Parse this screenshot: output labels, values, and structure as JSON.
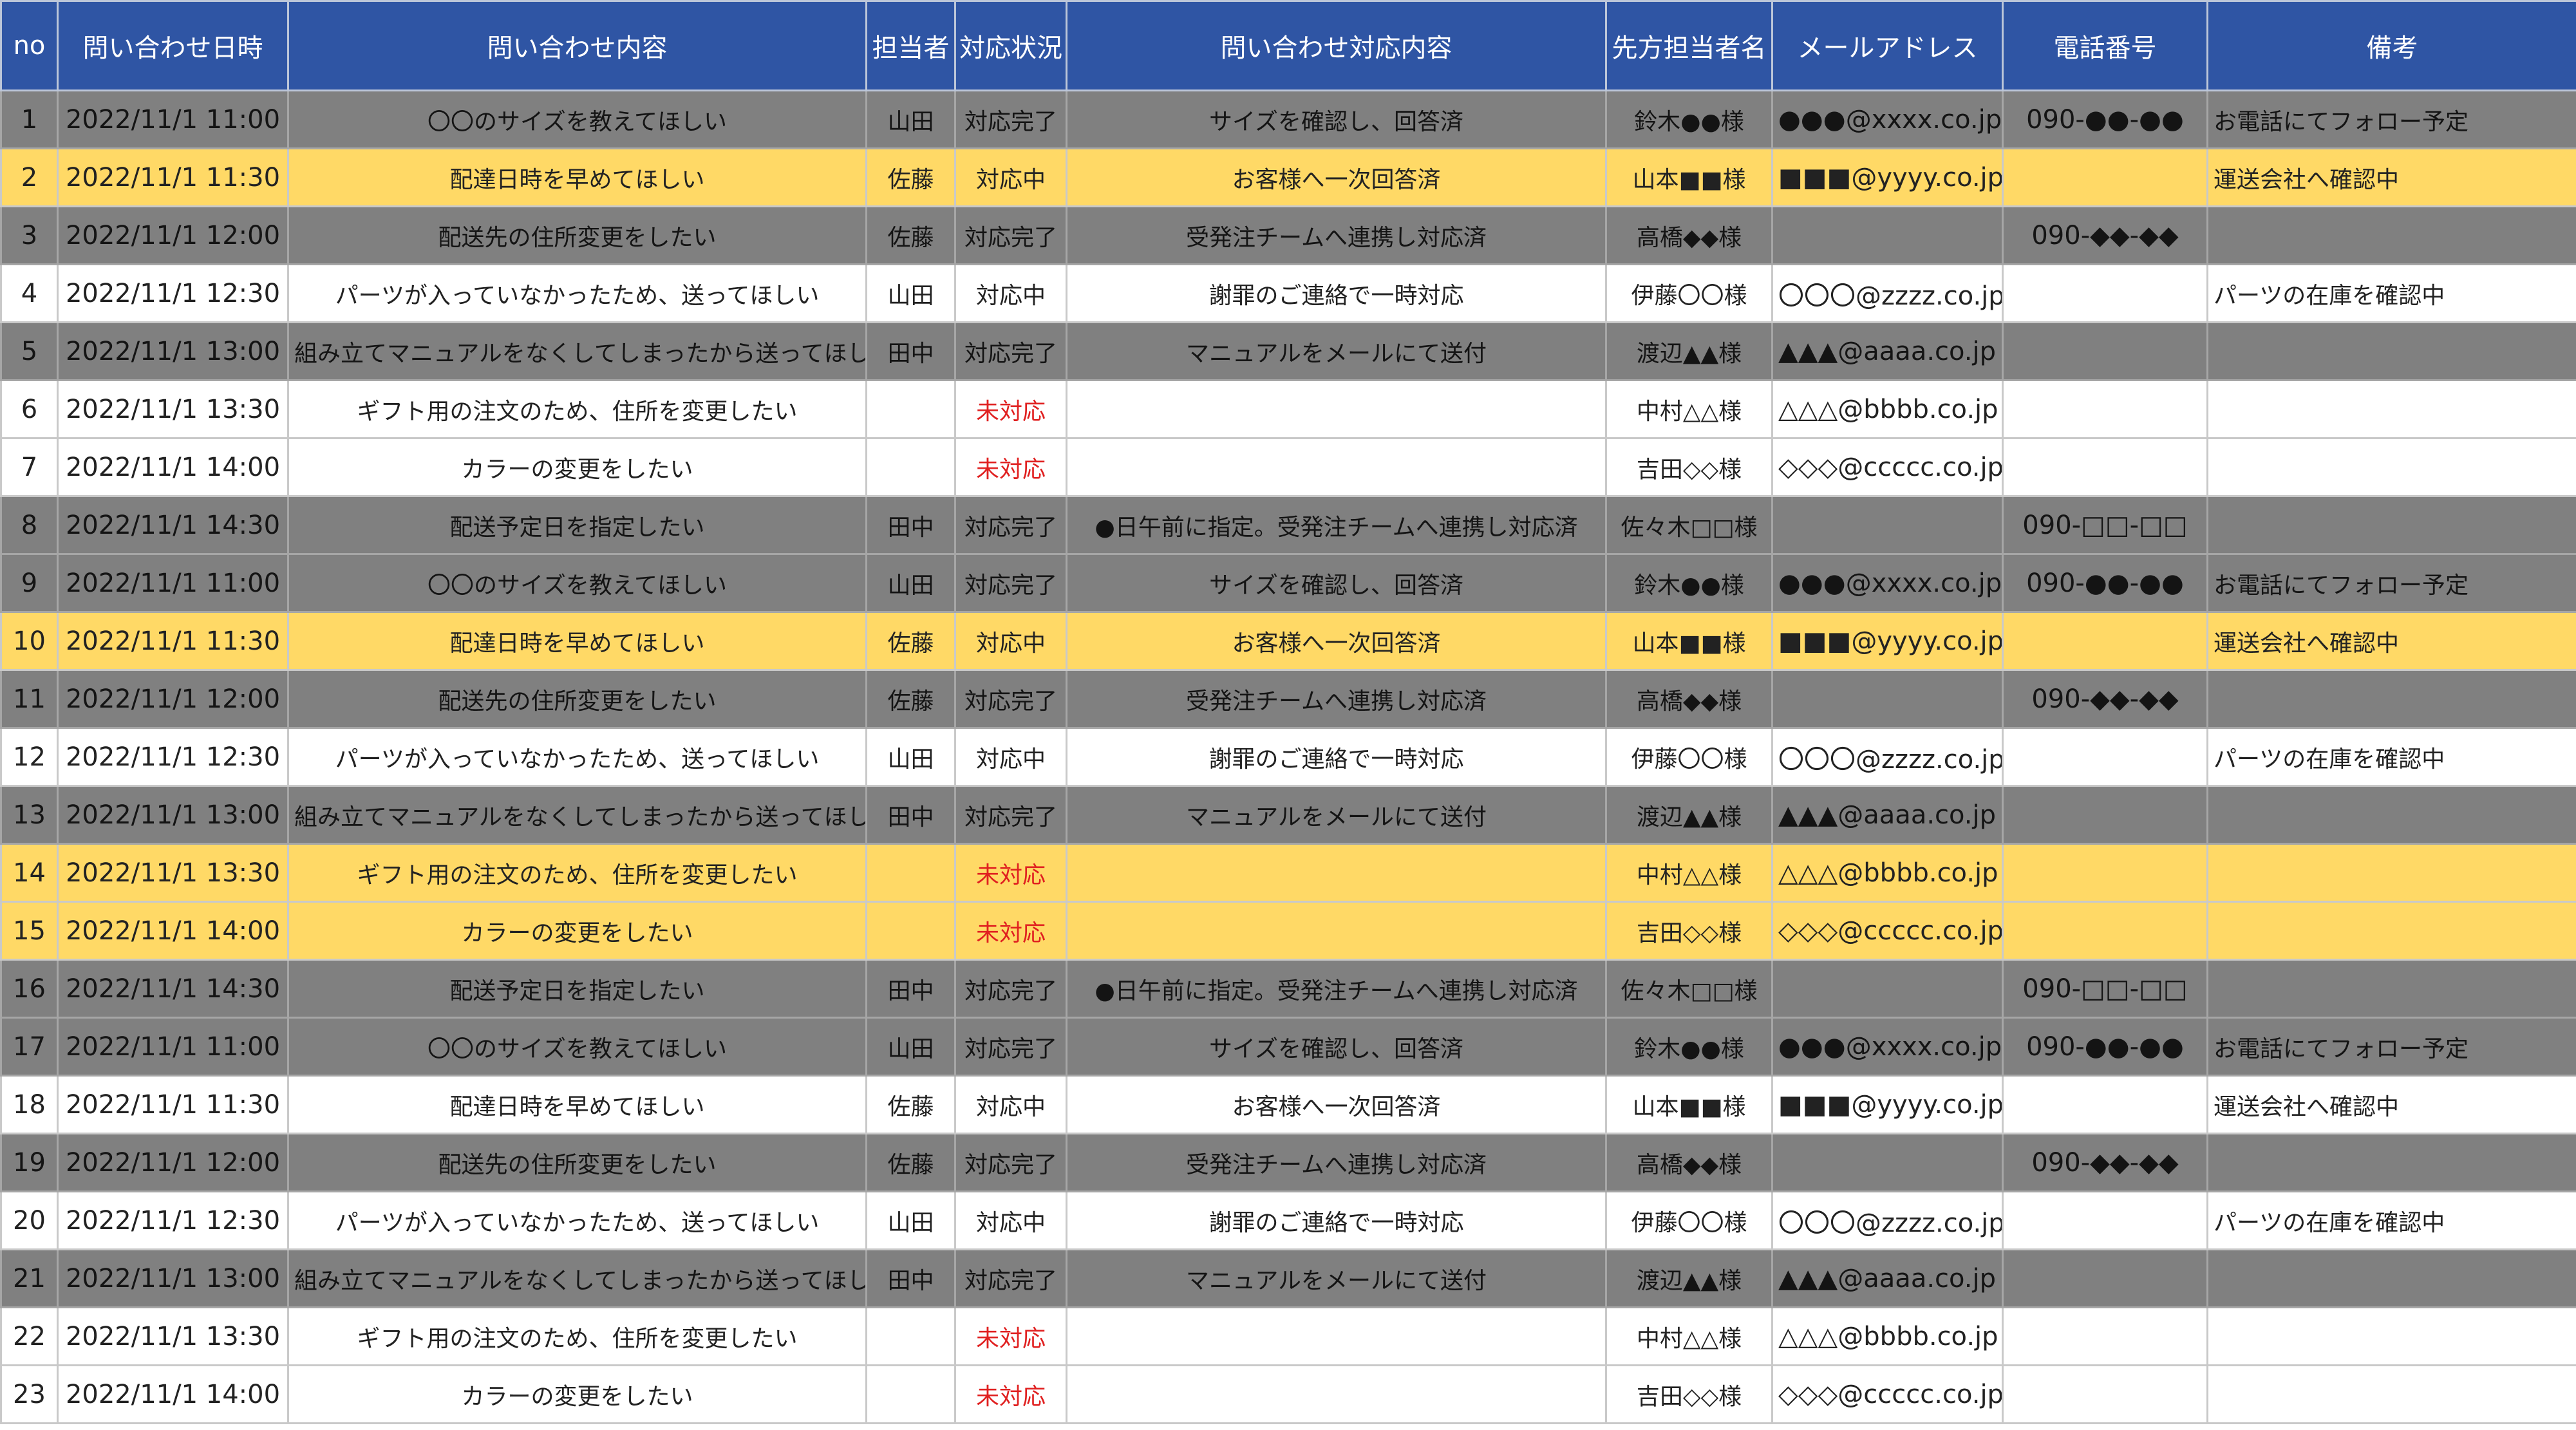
{
  "colors": {
    "header_bg": "#2f55a4",
    "gray_row": "#808080",
    "yellow_row": "#ffd966",
    "unhandled_text": "#e02020"
  },
  "header": {
    "no": "no",
    "datetime": "問い合わせ日時",
    "content": "問い合わせ内容",
    "staff": "担当者",
    "status": "対応状況",
    "response": "問い合わせ対応内容",
    "contact_name": "先方担当者名",
    "email": "メールアドレス",
    "phone": "電話番号",
    "note": "備考"
  },
  "rows": [
    {
      "no": "1",
      "datetime": "2022/11/1 11:00",
      "content": "〇〇のサイズを教えてほしい",
      "staff": "山田",
      "status": "対応完了",
      "response": "サイズを確認し、回答済",
      "contact_name": "鈴木●●様",
      "email": "●●●@xxxx.co.jp",
      "phone": "090-●●-●●",
      "note": "お電話にてフォロー予定",
      "style": "gray"
    },
    {
      "no": "2",
      "datetime": "2022/11/1 11:30",
      "content": "配達日時を早めてほしい",
      "staff": "佐藤",
      "status": "対応中",
      "response": "お客様へ一次回答済",
      "contact_name": "山本■■様",
      "email": "■■■@yyyy.co.jp",
      "phone": "",
      "note": "運送会社へ確認中",
      "style": "yellow"
    },
    {
      "no": "3",
      "datetime": "2022/11/1 12:00",
      "content": "配送先の住所変更をしたい",
      "staff": "佐藤",
      "status": "対応完了",
      "response": "受発注チームへ連携し対応済",
      "contact_name": "高橋◆◆様",
      "email": "",
      "phone": "090-◆◆-◆◆",
      "note": "",
      "style": "gray"
    },
    {
      "no": "4",
      "datetime": "2022/11/1 12:30",
      "content": "パーツが入っていなかったため、送ってほしい",
      "staff": "山田",
      "status": "対応中",
      "response": "謝罪のご連絡で一時対応",
      "contact_name": "伊藤〇〇様",
      "email": "〇〇〇@zzzz.co.jp",
      "phone": "",
      "note": "パーツの在庫を確認中",
      "style": "white"
    },
    {
      "no": "5",
      "datetime": "2022/11/1 13:00",
      "content": "組み立てマニュアルをなくしてしまったから送ってほしい",
      "staff": "田中",
      "status": "対応完了",
      "response": "マニュアルをメールにて送付",
      "contact_name": "渡辺▲▲様",
      "email": "▲▲▲@aaaa.co.jp",
      "phone": "",
      "note": "",
      "style": "gray"
    },
    {
      "no": "6",
      "datetime": "2022/11/1 13:30",
      "content": "ギフト用の注文のため、住所を変更したい",
      "staff": "",
      "status": "未対応",
      "response": "",
      "contact_name": "中村△△様",
      "email": "△△△@bbbb.co.jp",
      "phone": "",
      "note": "",
      "style": "white"
    },
    {
      "no": "7",
      "datetime": "2022/11/1 14:00",
      "content": "カラーの変更をしたい",
      "staff": "",
      "status": "未対応",
      "response": "",
      "contact_name": "吉田◇◇様",
      "email": "◇◇◇@ccccc.co.jp",
      "phone": "",
      "note": "",
      "style": "white"
    },
    {
      "no": "8",
      "datetime": "2022/11/1 14:30",
      "content": "配送予定日を指定したい",
      "staff": "田中",
      "status": "対応完了",
      "response": "●日午前に指定。受発注チームへ連携し対応済",
      "contact_name": "佐々木□□様",
      "email": "",
      "phone": "090-□□-□□",
      "note": "",
      "style": "gray"
    },
    {
      "no": "9",
      "datetime": "2022/11/1 11:00",
      "content": "〇〇のサイズを教えてほしい",
      "staff": "山田",
      "status": "対応完了",
      "response": "サイズを確認し、回答済",
      "contact_name": "鈴木●●様",
      "email": "●●●@xxxx.co.jp",
      "phone": "090-●●-●●",
      "note": "お電話にてフォロー予定",
      "style": "gray"
    },
    {
      "no": "10",
      "datetime": "2022/11/1 11:30",
      "content": "配達日時を早めてほしい",
      "staff": "佐藤",
      "status": "対応中",
      "response": "お客様へ一次回答済",
      "contact_name": "山本■■様",
      "email": "■■■@yyyy.co.jp",
      "phone": "",
      "note": "運送会社へ確認中",
      "style": "yellow"
    },
    {
      "no": "11",
      "datetime": "2022/11/1 12:00",
      "content": "配送先の住所変更をしたい",
      "staff": "佐藤",
      "status": "対応完了",
      "response": "受発注チームへ連携し対応済",
      "contact_name": "高橋◆◆様",
      "email": "",
      "phone": "090-◆◆-◆◆",
      "note": "",
      "style": "gray"
    },
    {
      "no": "12",
      "datetime": "2022/11/1 12:30",
      "content": "パーツが入っていなかったため、送ってほしい",
      "staff": "山田",
      "status": "対応中",
      "response": "謝罪のご連絡で一時対応",
      "contact_name": "伊藤〇〇様",
      "email": "〇〇〇@zzzz.co.jp",
      "phone": "",
      "note": "パーツの在庫を確認中",
      "style": "white"
    },
    {
      "no": "13",
      "datetime": "2022/11/1 13:00",
      "content": "組み立てマニュアルをなくしてしまったから送ってほしい",
      "staff": "田中",
      "status": "対応完了",
      "response": "マニュアルをメールにて送付",
      "contact_name": "渡辺▲▲様",
      "email": "▲▲▲@aaaa.co.jp",
      "phone": "",
      "note": "",
      "style": "gray"
    },
    {
      "no": "14",
      "datetime": "2022/11/1 13:30",
      "content": "ギフト用の注文のため、住所を変更したい",
      "staff": "",
      "status": "未対応",
      "response": "",
      "contact_name": "中村△△様",
      "email": "△△△@bbbb.co.jp",
      "phone": "",
      "note": "",
      "style": "yellow"
    },
    {
      "no": "15",
      "datetime": "2022/11/1 14:00",
      "content": "カラーの変更をしたい",
      "staff": "",
      "status": "未対応",
      "response": "",
      "contact_name": "吉田◇◇様",
      "email": "◇◇◇@ccccc.co.jp",
      "phone": "",
      "note": "",
      "style": "yellow"
    },
    {
      "no": "16",
      "datetime": "2022/11/1 14:30",
      "content": "配送予定日を指定したい",
      "staff": "田中",
      "status": "対応完了",
      "response": "●日午前に指定。受発注チームへ連携し対応済",
      "contact_name": "佐々木□□様",
      "email": "",
      "phone": "090-□□-□□",
      "note": "",
      "style": "gray"
    },
    {
      "no": "17",
      "datetime": "2022/11/1 11:00",
      "content": "〇〇のサイズを教えてほしい",
      "staff": "山田",
      "status": "対応完了",
      "response": "サイズを確認し、回答済",
      "contact_name": "鈴木●●様",
      "email": "●●●@xxxx.co.jp",
      "phone": "090-●●-●●",
      "note": "お電話にてフォロー予定",
      "style": "gray"
    },
    {
      "no": "18",
      "datetime": "2022/11/1 11:30",
      "content": "配達日時を早めてほしい",
      "staff": "佐藤",
      "status": "対応中",
      "response": "お客様へ一次回答済",
      "contact_name": "山本■■様",
      "email": "■■■@yyyy.co.jp",
      "phone": "",
      "note": "運送会社へ確認中",
      "style": "white"
    },
    {
      "no": "19",
      "datetime": "2022/11/1 12:00",
      "content": "配送先の住所変更をしたい",
      "staff": "佐藤",
      "status": "対応完了",
      "response": "受発注チームへ連携し対応済",
      "contact_name": "高橋◆◆様",
      "email": "",
      "phone": "090-◆◆-◆◆",
      "note": "",
      "style": "gray"
    },
    {
      "no": "20",
      "datetime": "2022/11/1 12:30",
      "content": "パーツが入っていなかったため、送ってほしい",
      "staff": "山田",
      "status": "対応中",
      "response": "謝罪のご連絡で一時対応",
      "contact_name": "伊藤〇〇様",
      "email": "〇〇〇@zzzz.co.jp",
      "phone": "",
      "note": "パーツの在庫を確認中",
      "style": "white"
    },
    {
      "no": "21",
      "datetime": "2022/11/1 13:00",
      "content": "組み立てマニュアルをなくしてしまったから送ってほしい",
      "staff": "田中",
      "status": "対応完了",
      "response": "マニュアルをメールにて送付",
      "contact_name": "渡辺▲▲様",
      "email": "▲▲▲@aaaa.co.jp",
      "phone": "",
      "note": "",
      "style": "gray"
    },
    {
      "no": "22",
      "datetime": "2022/11/1 13:30",
      "content": "ギフト用の注文のため、住所を変更したい",
      "staff": "",
      "status": "未対応",
      "response": "",
      "contact_name": "中村△△様",
      "email": "△△△@bbbb.co.jp",
      "phone": "",
      "note": "",
      "style": "white"
    },
    {
      "no": "23",
      "datetime": "2022/11/1 14:00",
      "content": "カラーの変更をしたい",
      "staff": "",
      "status": "未対応",
      "response": "",
      "contact_name": "吉田◇◇様",
      "email": "◇◇◇@ccccc.co.jp",
      "phone": "",
      "note": "",
      "style": "white"
    }
  ]
}
